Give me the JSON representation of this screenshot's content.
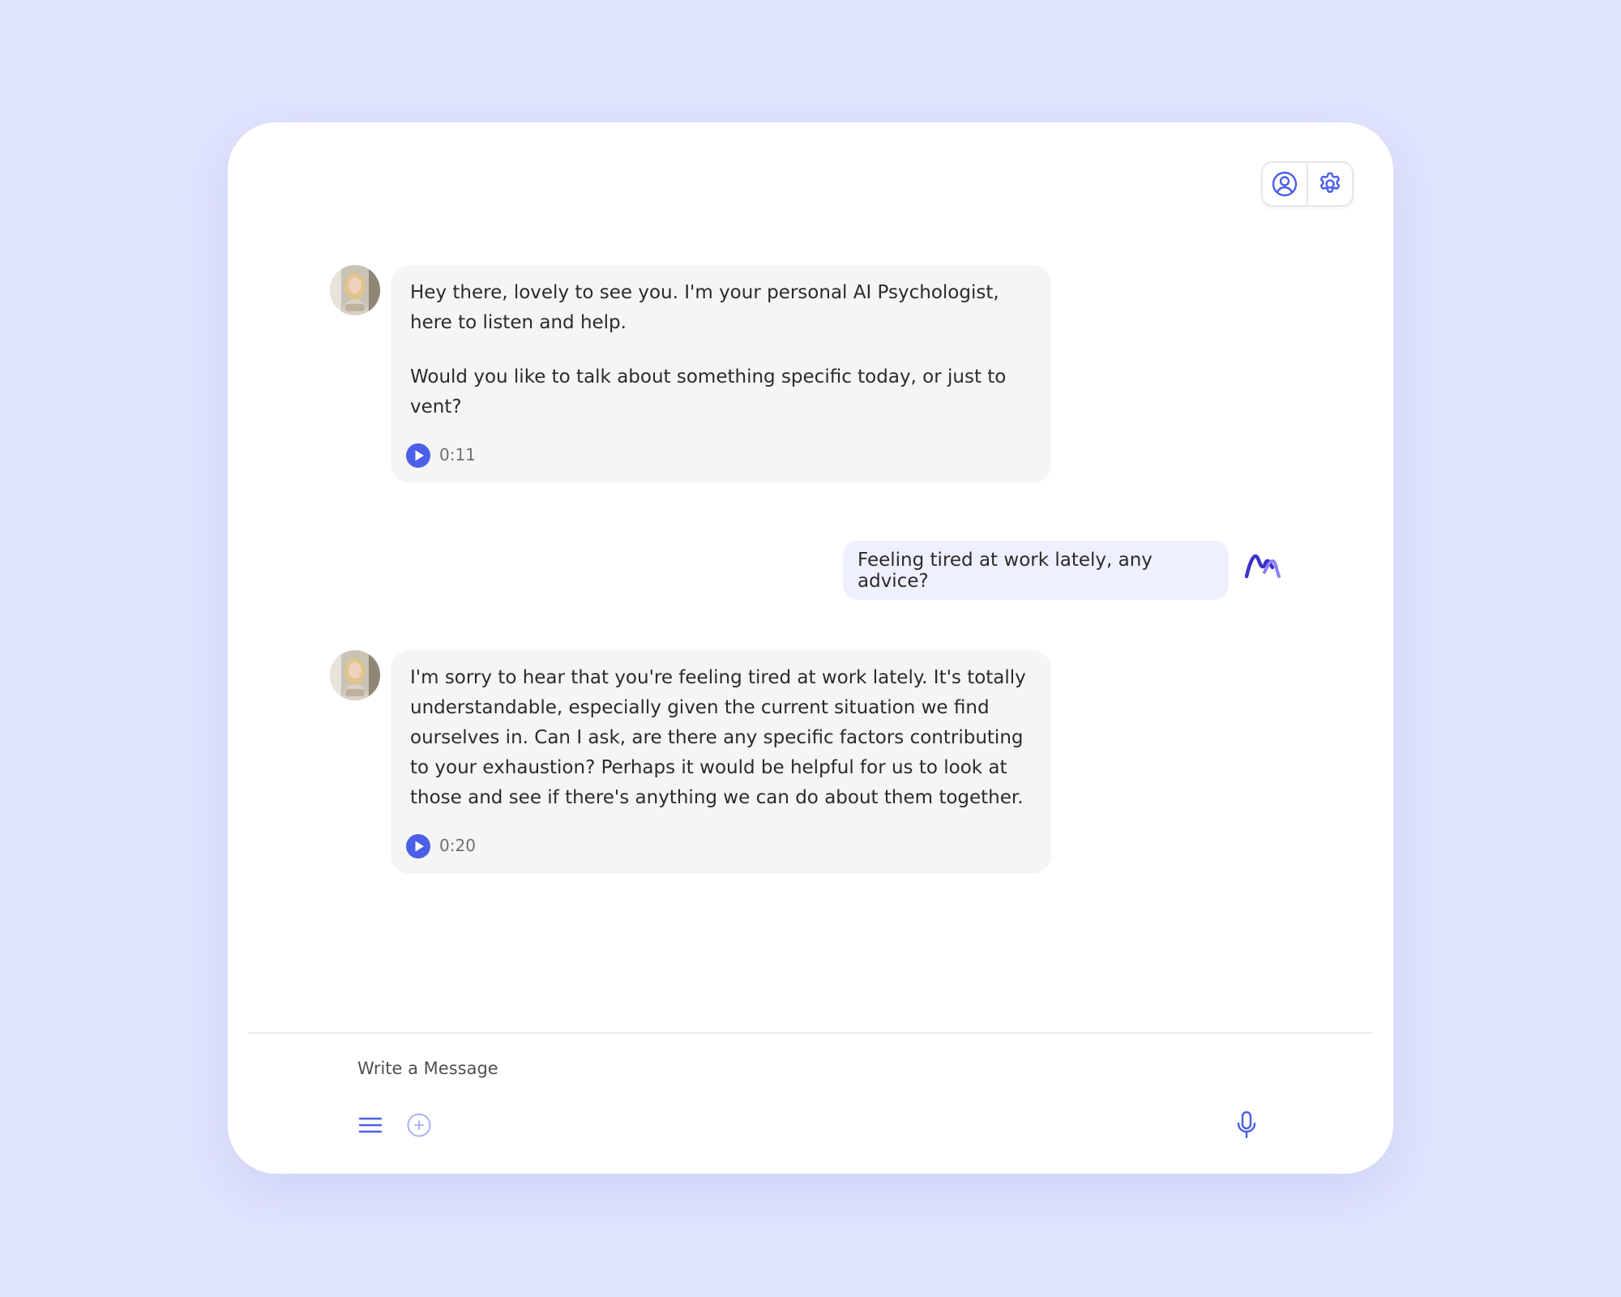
{
  "colors": {
    "background": "#e1e4fd",
    "accent": "#4b5fe8",
    "bot_bubble": "#f5f5f5",
    "user_bubble": "#eff0fd"
  },
  "header": {
    "icons": [
      "user-circle-icon",
      "gear-icon"
    ]
  },
  "messages": [
    {
      "sender": "bot",
      "paragraphs": [
        "Hey there, lovely to see you. I'm your personal AI Psychologist, here to listen and help.",
        "Would you like to talk about something specific today, or just to vent?"
      ],
      "audio_duration": "0:11"
    },
    {
      "sender": "user",
      "text": "Feeling tired at work lately, any advice?"
    },
    {
      "sender": "bot",
      "paragraphs": [
        "I'm sorry to hear that you're feeling tired at work lately. It's totally understandable, especially given the current situation we find ourselves in. Can I ask, are there any specific factors contributing to your exhaustion? Perhaps it would be helpful for us to look at those and see if there's anything we can do about them together."
      ],
      "audio_duration": "0:20"
    }
  ],
  "composer": {
    "placeholder": "Write a Message",
    "icons": [
      "menu-icon",
      "add-icon",
      "microphone-icon"
    ]
  }
}
